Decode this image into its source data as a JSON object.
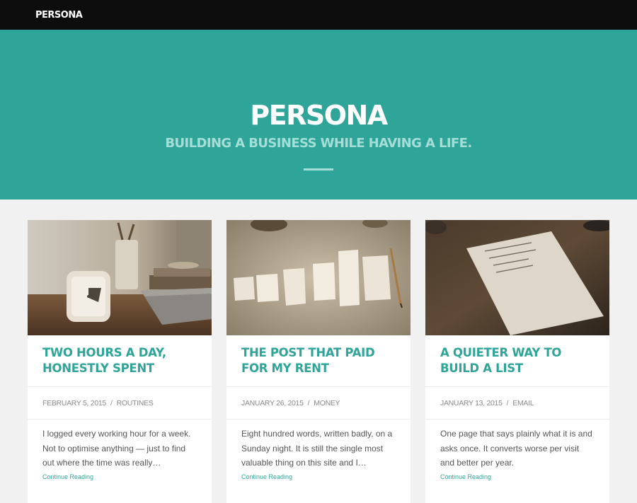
{
  "nav": {
    "logo": "PERSONA"
  },
  "hero": {
    "title": "PERSONA",
    "tagline": "BUILDING A BUSINESS WHILE HAVING A LIFE."
  },
  "posts": [
    {
      "title": "TWO HOURS A DAY, HONESTLY SPENT",
      "date": "FEBRUARY 5, 2015",
      "category": "ROUTINES",
      "excerpt": "I logged every working hour for a week. Not to optimise anything — just to find out where the time was really…",
      "more": "Continue Reading"
    },
    {
      "title": "THE POST THAT PAID FOR MY RENT",
      "date": "JANUARY 26, 2015",
      "category": "MONEY",
      "excerpt": "Eight hundred words, written badly, on a Sunday night. It is still the single most valuable thing on this site and I…",
      "more": "Continue Reading"
    },
    {
      "title": "A QUIETER WAY TO BUILD A LIST",
      "date": "JANUARY 13, 2015",
      "category": "EMAIL",
      "excerpt": "One page that says plainly what it is and asks once. It converts worse per visit and better per year.",
      "more": "Continue Reading"
    }
  ],
  "separator": "/"
}
